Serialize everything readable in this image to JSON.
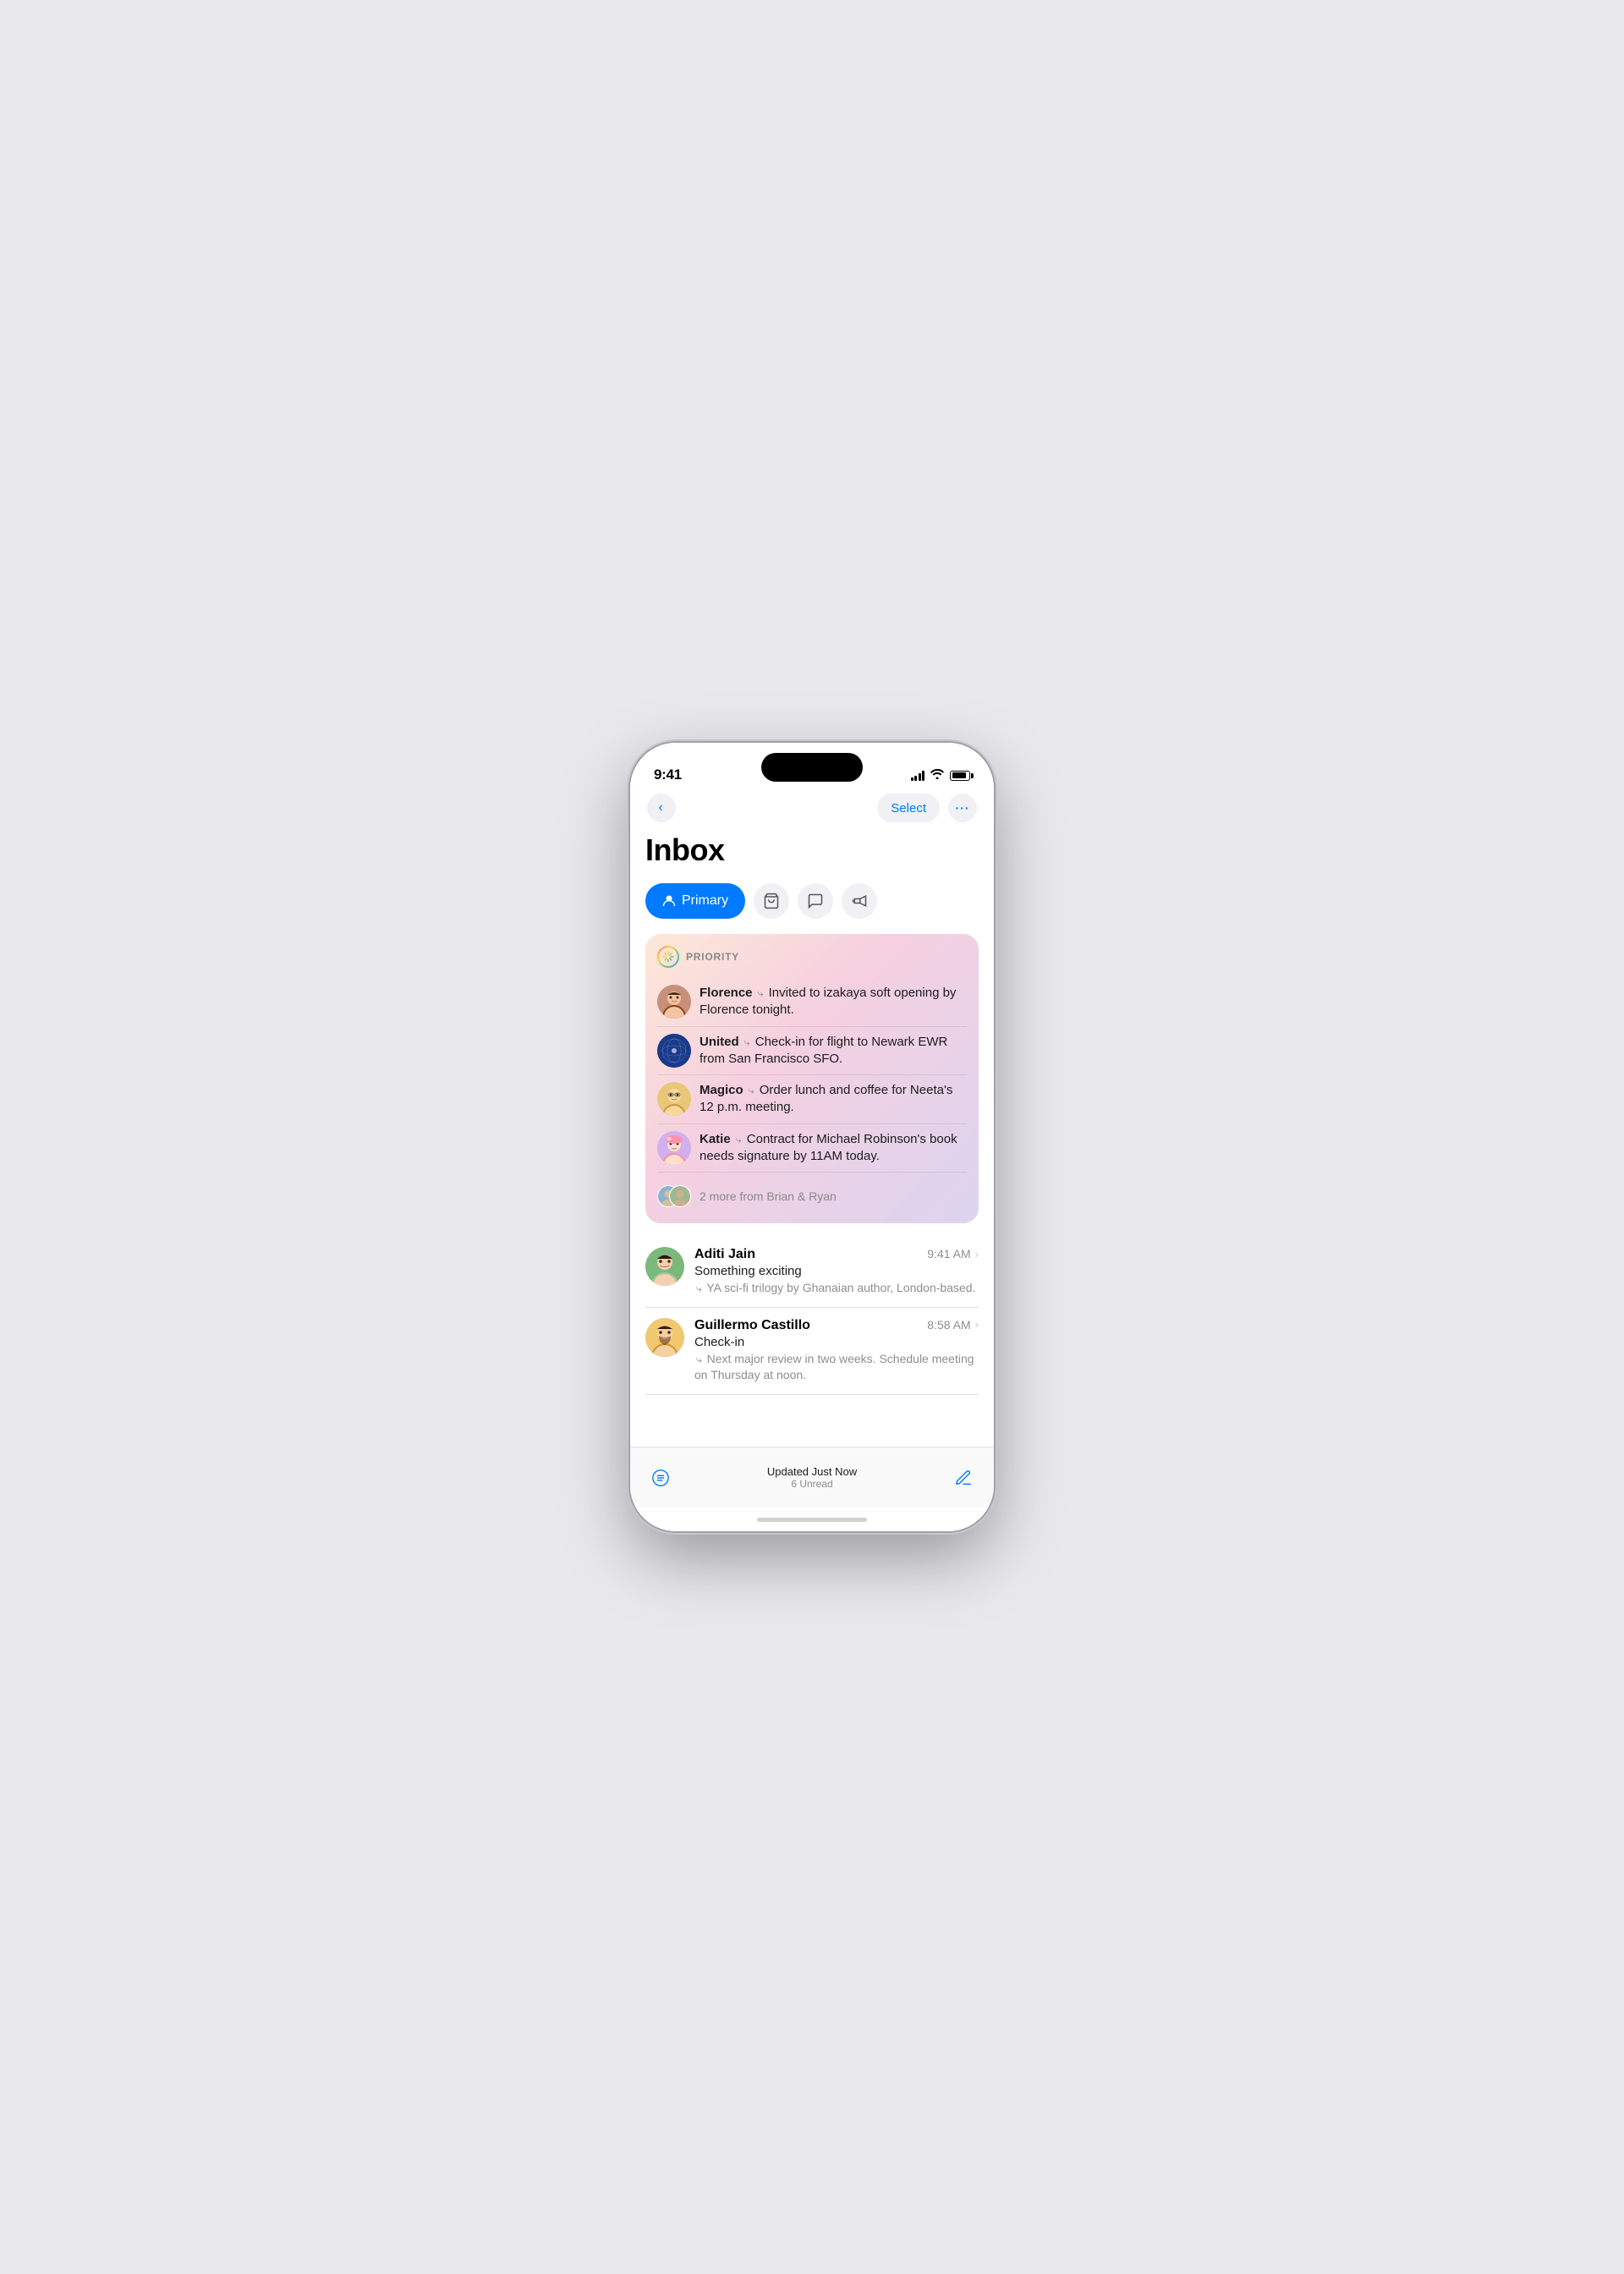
{
  "phone": {
    "time": "9:41",
    "battery_level": 85
  },
  "nav": {
    "select_label": "Select",
    "more_label": "···"
  },
  "page": {
    "title": "Inbox"
  },
  "tabs": [
    {
      "id": "primary",
      "label": "Primary",
      "icon": "person",
      "active": true
    },
    {
      "id": "shopping",
      "label": "Shopping",
      "icon": "cart",
      "active": false
    },
    {
      "id": "messages",
      "label": "Messages",
      "icon": "message",
      "active": false
    },
    {
      "id": "promotions",
      "label": "Promotions",
      "icon": "megaphone",
      "active": false
    }
  ],
  "priority": {
    "label": "PRIORITY",
    "items": [
      {
        "sender": "Florence",
        "preview": "Invited to izakaya soft opening by Florence tonight.",
        "avatar_type": "florence"
      },
      {
        "sender": "United",
        "preview": "Check-in for flight to Newark EWR from San Francisco SFO.",
        "avatar_type": "united"
      },
      {
        "sender": "Magico",
        "preview": "Order lunch and coffee for Neeta's 12 p.m. meeting.",
        "avatar_type": "magico"
      },
      {
        "sender": "Katie",
        "preview": "Contract for Michael Robinson's book needs signature by 11AM today.",
        "avatar_type": "katie"
      }
    ],
    "more_text": "2 more from Brian & Ryan"
  },
  "emails": [
    {
      "sender": "Aditi Jain",
      "time": "9:41 AM",
      "subject": "Something exciting",
      "preview": "YA sci-fi trilogy by Ghanaian author, London-based.",
      "avatar_type": "aditi"
    },
    {
      "sender": "Guillermo Castillo",
      "time": "8:58 AM",
      "subject": "Check-in",
      "preview": "Next major review in two weeks. Schedule meeting on Thursday at noon.",
      "avatar_type": "guillermo"
    }
  ],
  "bottom_bar": {
    "status_title": "Updated Just Now",
    "status_sub": "6 Unread"
  }
}
